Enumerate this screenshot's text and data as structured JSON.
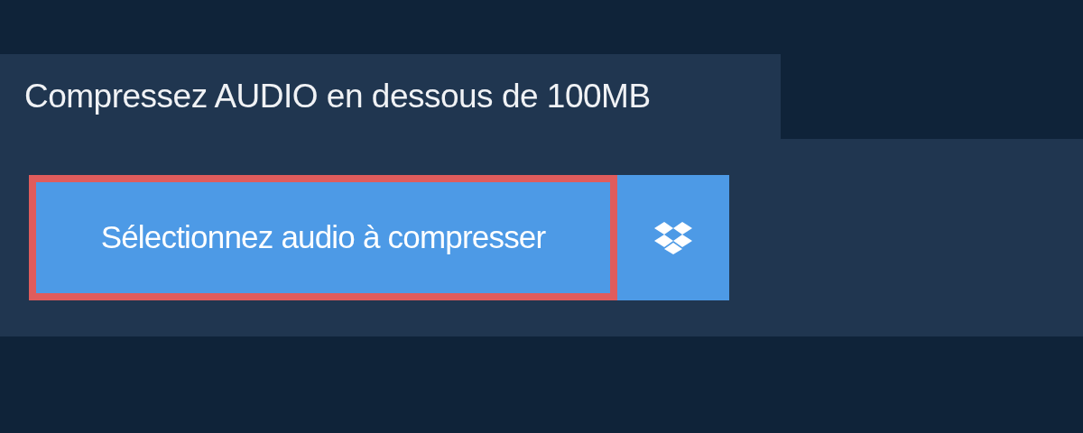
{
  "tab": {
    "title": "Compressez AUDIO en dessous de 100MB"
  },
  "select_button": {
    "label": "Sélectionnez audio à compresser",
    "focused": true
  },
  "dropbox_button": {
    "kind": "dropbox"
  }
}
